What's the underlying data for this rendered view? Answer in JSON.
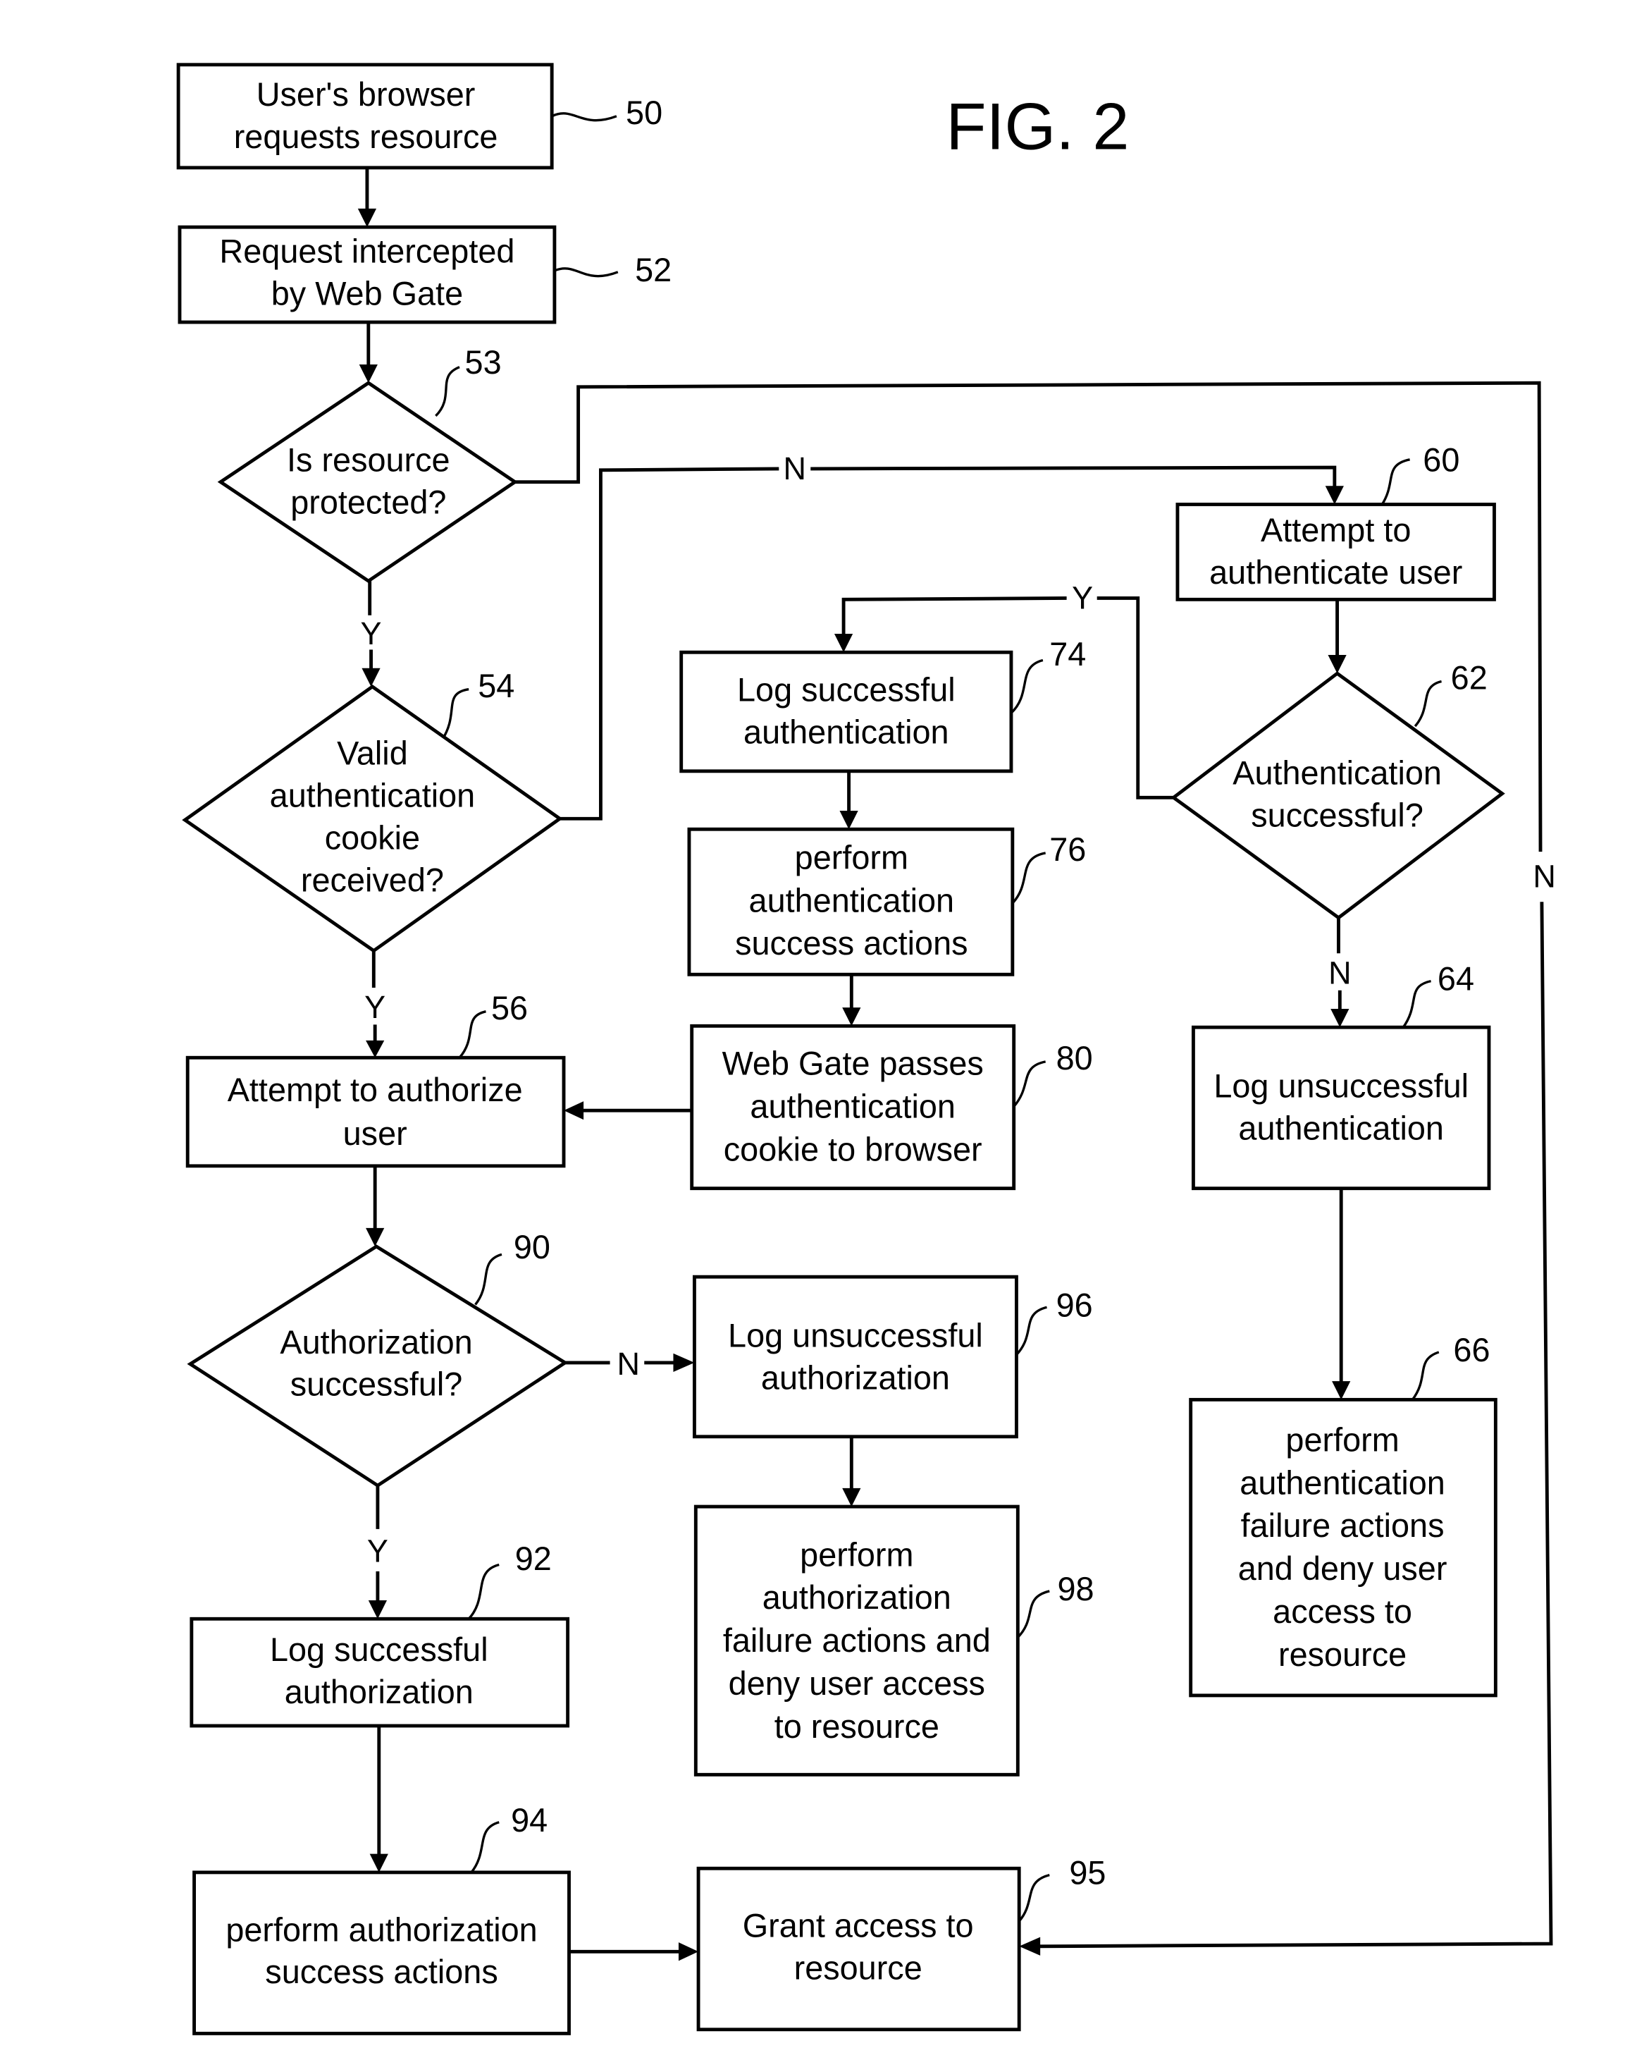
{
  "figure": {
    "title": "FIG. 2"
  },
  "nodes": {
    "n50": {
      "ref": "50",
      "type": "process",
      "lines": [
        "User's browser",
        "requests resource"
      ]
    },
    "n52": {
      "ref": "52",
      "type": "process",
      "lines": [
        "Request intercepted",
        "by Web Gate"
      ]
    },
    "n53": {
      "ref": "53",
      "type": "decision",
      "lines": [
        "Is resource",
        "protected?"
      ]
    },
    "n54": {
      "ref": "54",
      "type": "decision",
      "lines": [
        "Valid",
        "authentication",
        "cookie",
        "received?"
      ]
    },
    "n56": {
      "ref": "56",
      "type": "process",
      "lines": [
        "Attempt to authorize",
        "user"
      ]
    },
    "n60": {
      "ref": "60",
      "type": "process",
      "lines": [
        "Attempt to",
        "authenticate user"
      ]
    },
    "n62": {
      "ref": "62",
      "type": "decision",
      "lines": [
        "Authentication",
        "successful?"
      ]
    },
    "n64": {
      "ref": "64",
      "type": "process",
      "lines": [
        "Log unsuccessful",
        "authentication"
      ]
    },
    "n66": {
      "ref": "66",
      "type": "process",
      "lines": [
        "perform",
        "authentication",
        "failure actions",
        "and deny user",
        "access  to",
        "resource"
      ]
    },
    "n74": {
      "ref": "74",
      "type": "process",
      "lines": [
        "Log successful",
        "authentication"
      ]
    },
    "n76": {
      "ref": "76",
      "type": "process",
      "lines": [
        "perform",
        "authentication",
        "success actions"
      ]
    },
    "n80": {
      "ref": "80",
      "type": "process",
      "lines": [
        "Web Gate passes",
        "authentication",
        "cookie to browser"
      ]
    },
    "n90": {
      "ref": "90",
      "type": "decision",
      "lines": [
        "Authorization",
        "successful?"
      ]
    },
    "n92": {
      "ref": "92",
      "type": "process",
      "lines": [
        "Log successful",
        "authorization"
      ]
    },
    "n94": {
      "ref": "94",
      "type": "process",
      "lines": [
        "perform authorization",
        "success actions"
      ]
    },
    "n95": {
      "ref": "95",
      "type": "process",
      "lines": [
        "Grant access to",
        "resource"
      ]
    },
    "n96": {
      "ref": "96",
      "type": "process",
      "lines": [
        "Log unsuccessful",
        "authorization"
      ]
    },
    "n98": {
      "ref": "98",
      "type": "process",
      "lines": [
        "perform",
        "authorization",
        "failure actions and",
        "deny user access",
        "to resource"
      ]
    }
  },
  "edges": [
    {
      "from": "50",
      "to": "52",
      "label": ""
    },
    {
      "from": "52",
      "to": "53",
      "label": ""
    },
    {
      "from": "53",
      "to": "54",
      "label": "Y"
    },
    {
      "from": "53",
      "to": "95",
      "label": "N"
    },
    {
      "from": "54",
      "to": "56",
      "label": "Y"
    },
    {
      "from": "54",
      "to": "60",
      "label": "N"
    },
    {
      "from": "60",
      "to": "62",
      "label": ""
    },
    {
      "from": "62",
      "to": "74",
      "label": "Y"
    },
    {
      "from": "62",
      "to": "64",
      "label": "N"
    },
    {
      "from": "64",
      "to": "66",
      "label": ""
    },
    {
      "from": "74",
      "to": "76",
      "label": ""
    },
    {
      "from": "76",
      "to": "80",
      "label": ""
    },
    {
      "from": "80",
      "to": "56",
      "label": ""
    },
    {
      "from": "56",
      "to": "90",
      "label": ""
    },
    {
      "from": "90",
      "to": "92",
      "label": "Y"
    },
    {
      "from": "90",
      "to": "96",
      "label": "N"
    },
    {
      "from": "92",
      "to": "94",
      "label": ""
    },
    {
      "from": "94",
      "to": "95",
      "label": ""
    },
    {
      "from": "96",
      "to": "98",
      "label": ""
    }
  ]
}
